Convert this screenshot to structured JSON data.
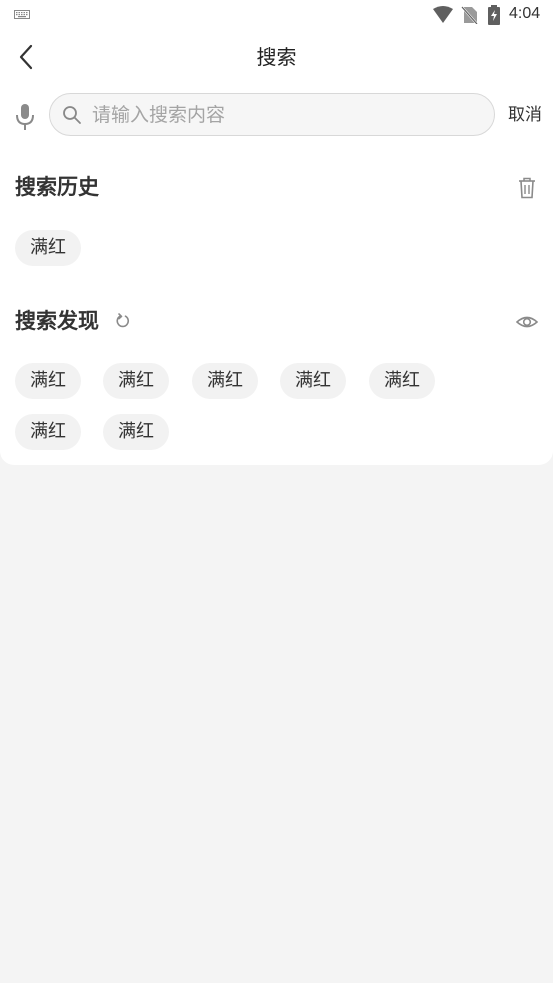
{
  "status_bar": {
    "time": "4:04",
    "icons": [
      "keyboard-icon",
      "wifi-icon",
      "no-sim-icon",
      "battery-charging-icon"
    ]
  },
  "header": {
    "title": "搜索",
    "back_icon": "back-arrow-icon"
  },
  "search": {
    "placeholder": "请输入搜索内容",
    "value": "",
    "cancel_label": "取消",
    "mic_icon": "microphone-icon",
    "search_icon": "search-icon"
  },
  "history": {
    "title": "搜索历史",
    "clear_icon": "trash-icon",
    "items": [
      "满红"
    ]
  },
  "discover": {
    "title": "搜索发现",
    "refresh_icon": "refresh-icon",
    "visibility_icon": "eye-icon",
    "items": [
      "满红",
      "满红",
      "满红",
      "满红",
      "满红",
      "满红",
      "满红"
    ]
  },
  "colors": {
    "background": "#f4f4f4",
    "card": "#ffffff",
    "chip": "#f2f2f2",
    "text": "#333333",
    "placeholder": "#a4a4a4",
    "icon": "#8a8a8a"
  }
}
